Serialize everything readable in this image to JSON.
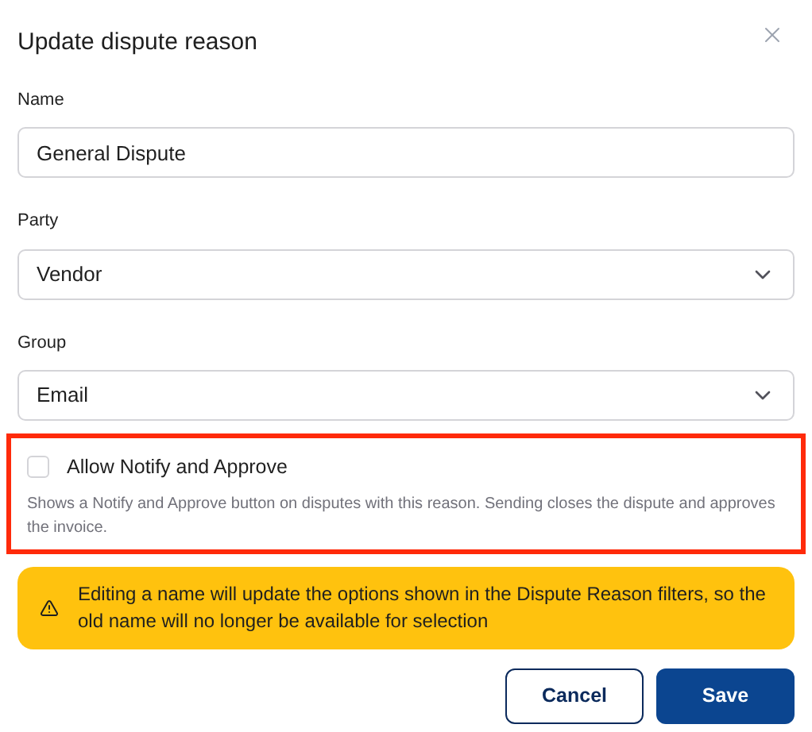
{
  "dialog": {
    "title": "Update dispute reason"
  },
  "fields": [
    {
      "kind": "text",
      "label": "Name",
      "value": "General Dispute"
    },
    {
      "kind": "select",
      "label": "Party",
      "value": "Vendor"
    },
    {
      "kind": "select",
      "label": "Group",
      "value": "Email"
    }
  ],
  "option": {
    "label": "Allow Notify and Approve",
    "checked": false,
    "description": "Shows a Notify and Approve button on disputes with this reason. Sending closes the dispute and approves the invoice.",
    "highlighted": true
  },
  "warning": {
    "text": "Editing a name will update the options shown in the Dispute Reason filters, so the old name will no longer be available for selection"
  },
  "buttons": [
    {
      "label": "Cancel",
      "kind": "secondary"
    },
    {
      "label": "Save",
      "kind": "primary"
    }
  ]
}
